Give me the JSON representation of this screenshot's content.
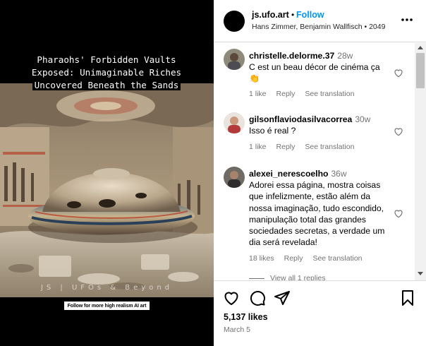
{
  "post": {
    "image_caption_lines": [
      "Pharaohs' Forbidden Vaults",
      "Exposed: Unimaginable Riches",
      "Uncovered Beneath the Sands"
    ],
    "watermark": "JS | UFOs & Beyond",
    "follow_tag": "Follow for more high realism AI art"
  },
  "header": {
    "username": "js.ufo.art",
    "separator": "•",
    "follow_label": "Follow",
    "audio": "Hans Zimmer, Benjamin Wallfisch • 2049",
    "more_icon": "more-horizontal-icon"
  },
  "comments": [
    {
      "username": "christelle.delorme.37",
      "time": "28w",
      "text": "C est un beau décor de cinéma ça 👏",
      "likes": "1 like",
      "reply": "Reply",
      "translate": "See translation"
    },
    {
      "username": "gilsonflaviodasilvacorrea",
      "time": "30w",
      "text": "Isso é real ?",
      "likes": "1 like",
      "reply": "Reply",
      "translate": "See translation"
    },
    {
      "username": "alexei_nerescoelho",
      "time": "36w",
      "text": "Adorei essa página, mostra coisas que infelizmente, estão além da nossa imaginação, tudo escondido, manipulação total das grandes sociedades secretas, a verdade um dia será revelada!",
      "likes": "18 likes",
      "reply": "Reply",
      "translate": "See translation"
    }
  ],
  "view_replies": "View all 1 replies",
  "actions": {
    "icons": [
      "heart-icon",
      "comment-icon",
      "share-icon",
      "bookmark-icon"
    ],
    "likes": "5,137 likes",
    "date": "March 5"
  }
}
